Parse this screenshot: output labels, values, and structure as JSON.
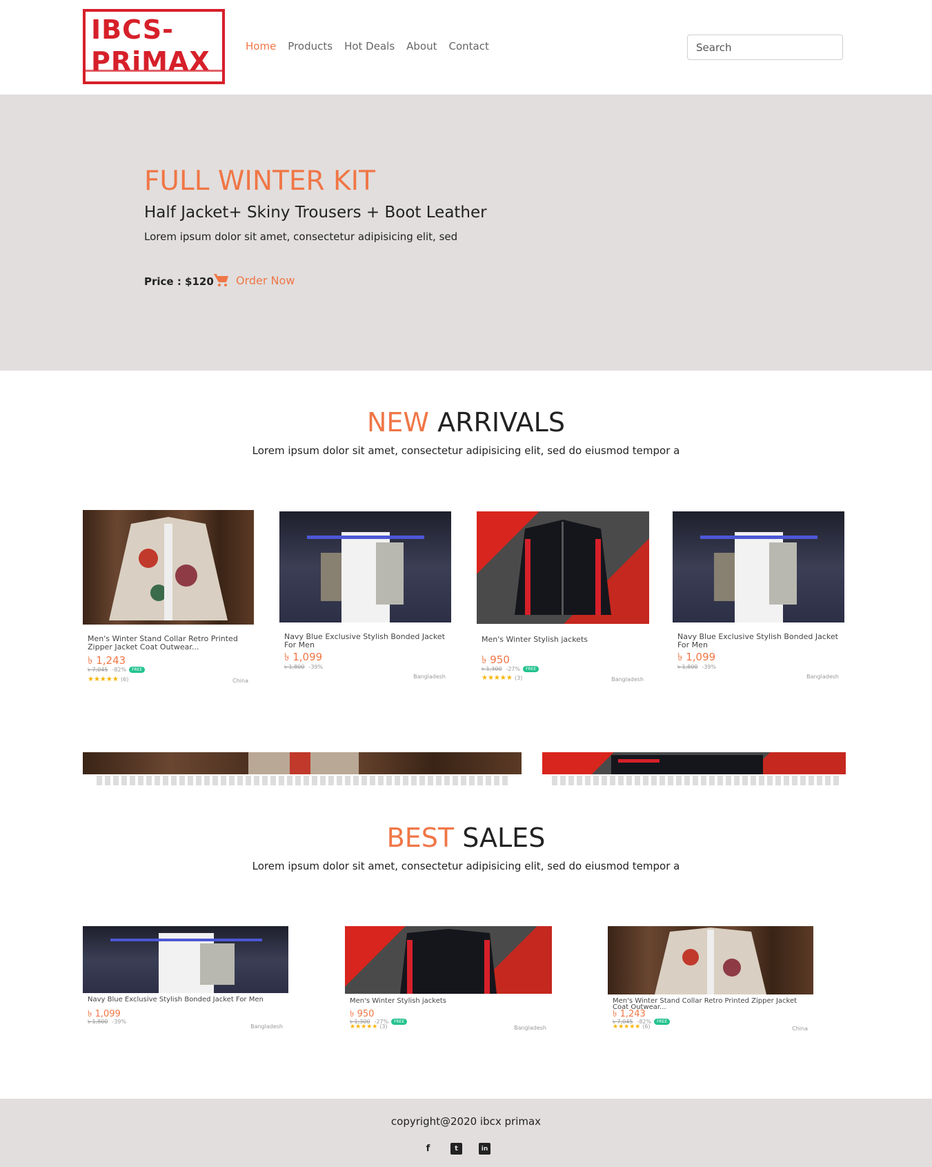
{
  "header": {
    "logo_line1": "IBCS-",
    "logo_line2": "PRiMAX",
    "nav": [
      "Home",
      "Products",
      "Hot Deals",
      "About",
      "Contact"
    ],
    "search_placeholder": "Search"
  },
  "hero": {
    "title": "FULL WINTER KIT",
    "subtitle": "Half Jacket+ Skiny Trousers + Boot Leather",
    "text": "Lorem ipsum dolor sit amet, consectetur adipisicing elit, sed",
    "price": "Price : $120",
    "order_label": "Order Now"
  },
  "new_arrivals": {
    "title_accent": "NEW",
    "title_rest": "ARRIVALS",
    "desc": "Lorem ipsum dolor sit amet, consectetur adipisicing elit, sed do eiusmod tempor a",
    "products": [
      {
        "name": "Men's Winter Stand Collar Retro Printed Zipper Jacket Coat Outwear...",
        "price": "৳ 1,243",
        "old_price": "৳ 7,045",
        "discount": "-82%",
        "free": "FREE",
        "rating": "★★★★★",
        "reviews": "(6)",
        "origin": "China"
      },
      {
        "name": "Navy Blue Exclusive Stylish Bonded Jacket For Men",
        "price": "৳ 1,099",
        "old_price": "৳ 1,800",
        "discount": "-39%",
        "origin": "Bangladesh"
      },
      {
        "name": "Men's Winter Stylish jackets",
        "price": "৳ 950",
        "old_price": "৳ 1,300",
        "discount": "-27%",
        "free": "FREE",
        "rating": "★★★★★",
        "reviews": "(3)",
        "origin": "Bangladesh"
      },
      {
        "name": "Navy Blue Exclusive Stylish Bonded Jacket For Men",
        "price": "৳ 1,099",
        "old_price": "৳ 1,800",
        "discount": "-39%",
        "origin": "Bangladesh"
      }
    ]
  },
  "best_sales": {
    "title_accent": "BEST",
    "title_rest": "SALES",
    "desc": "Lorem ipsum dolor sit amet, consectetur adipisicing elit, sed do eiusmod tempor a",
    "products": [
      {
        "name": "Navy Blue Exclusive Stylish Bonded Jacket For Men",
        "price": "৳ 1,099",
        "old_price": "৳ 1,800",
        "discount": "-39%",
        "origin": "Bangladesh"
      },
      {
        "name": "Men's Winter Stylish jackets",
        "price": "৳ 950",
        "old_price": "৳ 1,300",
        "discount": "-27%",
        "free": "FREE",
        "rating": "★★★★★",
        "reviews": "(3)",
        "origin": "Bangladesh"
      },
      {
        "name": "Men's Winter Stand Collar Retro Printed Zipper Jacket Coat Outwear...",
        "price": "৳ 1,243",
        "old_price": "৳ 7,045",
        "discount": "-82%",
        "free": "FREE",
        "rating": "★★★★★",
        "reviews": "(6)",
        "origin": "China"
      }
    ]
  },
  "footer": {
    "copyright": "copyright@2020 ibcx primax",
    "social": [
      "f",
      "t",
      "in"
    ]
  },
  "colors": {
    "accent": "#f07646",
    "logo_red": "#d6202a",
    "band": "#e1dedd"
  }
}
